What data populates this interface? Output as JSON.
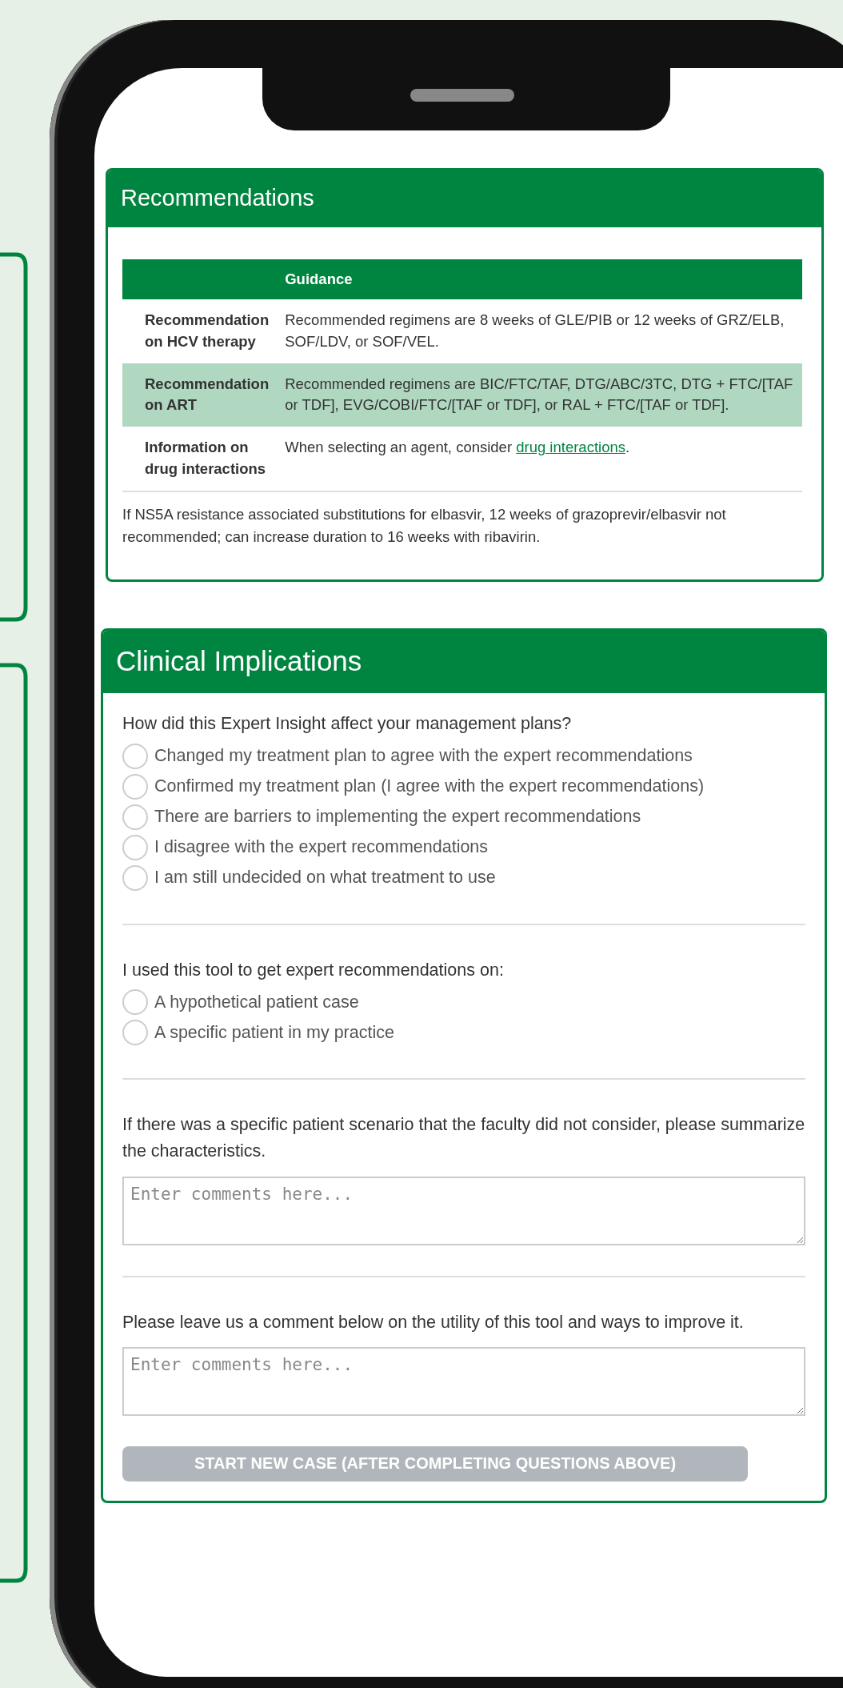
{
  "recommendations": {
    "title": "Recommendations",
    "table": {
      "columns": [
        {
          "label": "Guidance"
        }
      ],
      "rows": [
        {
          "label": "Recommendation on HCV therapy",
          "highlighted": false,
          "guidance": "Recommended regimens are 8 weeks of GLE/PIB or 12 weeks of GRZ/ELB, SOF/LDV, or SOF/VEL."
        },
        {
          "label": "Recommendation on ART",
          "highlighted": true,
          "guidance": "Recommended regimens are BIC/FTC/TAF, DTG/ABC/3TC, DTG + FTC/[TAF or TDF], EVG/COBI/FTC/[TAF or TDF], or RAL + FTC/[TAF or TDF]."
        },
        {
          "label": "Information on drug interactions",
          "highlighted": false,
          "guidance": "When selecting an agent, consider ",
          "link": "drug interactions",
          "after": "."
        }
      ]
    },
    "note": "If NS5A resistance associated substitutions for elbasvir, 12 weeks of grazoprevir/elbasvir not recommended; can increase duration to 16 weeks with ribavirin."
  },
  "clinical": {
    "title": "Clinical Implications",
    "questions": [
      {
        "kind": "radio",
        "prompt": "How did this Expert Insight affect your management plans?",
        "options": [
          {
            "label": "Changed my treatment plan to agree with the expert recommendations",
            "selected": false
          },
          {
            "label": "Confirmed my treatment plan (I agree with the expert recommendations)",
            "selected": false
          },
          {
            "label": "There are barriers to implementing the expert recommendations",
            "selected": false
          },
          {
            "label": "I disagree with the expert recommendations",
            "selected": false
          },
          {
            "label": "I am still undecided on what treatment to use",
            "selected": false
          }
        ]
      },
      {
        "kind": "radio",
        "prompt": "I used this tool to get expert recommendations on:",
        "options": [
          {
            "label": "A hypothetical patient case",
            "selected": false
          },
          {
            "label": "A specific patient in my practice",
            "selected": false
          }
        ]
      },
      {
        "kind": "text",
        "prompt": "If there was a specific patient scenario that the faculty did not consider, please summarize the characteristics.",
        "placeholder": "Enter comments here..."
      },
      {
        "kind": "text",
        "prompt": "Please leave us a comment below on the utility of this tool and ways to improve it.",
        "placeholder": "Enter comments here..."
      }
    ],
    "button": {
      "label": "START NEW CASE (AFTER COMPLETING QUESTIONS ABOVE)",
      "disabled": true
    }
  }
}
